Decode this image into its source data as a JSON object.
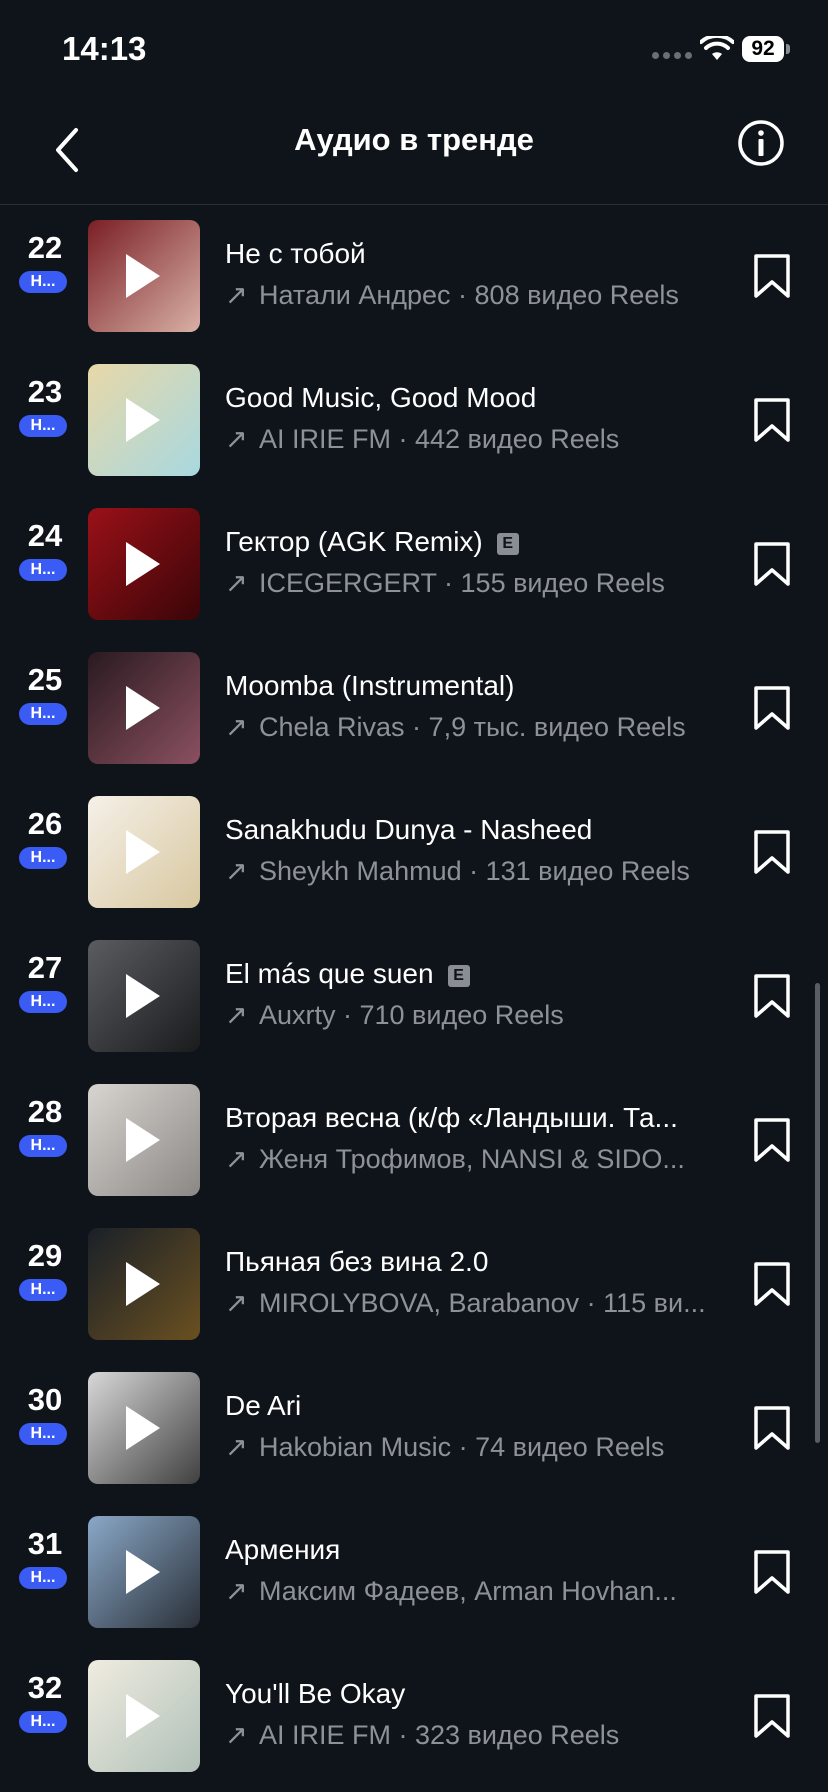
{
  "status": {
    "time": "14:13",
    "battery": "92"
  },
  "header": {
    "title": "Аудио в тренде"
  },
  "badge_label": "Н...",
  "tracks": [
    {
      "rank": "22",
      "title": "Не с тобой",
      "explicit": false,
      "meta": "Натали Андрес · 808 видео Reels",
      "color1": "#7a1f25",
      "color2": "#d8b0a5"
    },
    {
      "rank": "23",
      "title": "Good Music, Good Mood",
      "explicit": false,
      "meta": "AI IRIE FM · 442 видео Reels",
      "color1": "#e8d8a8",
      "color2": "#a8d8e0"
    },
    {
      "rank": "24",
      "title": "Гектор (AGK Remix)",
      "explicit": true,
      "meta": "ICEGERGERT · 155 видео Reels",
      "color1": "#9a1118",
      "color2": "#3a0508"
    },
    {
      "rank": "25",
      "title": "Moomba (Instrumental)",
      "explicit": false,
      "meta": "Chela Rivas · 7,9 тыс. видео Reels",
      "color1": "#2a1a20",
      "color2": "#8a5060"
    },
    {
      "rank": "26",
      "title": "Sanakhudu Dunya - Nasheed",
      "explicit": false,
      "meta": "Sheykh Mahmud · 131 видео Reels",
      "color1": "#f5f0e8",
      "color2": "#d8c8a0"
    },
    {
      "rank": "27",
      "title": "El más que suen",
      "explicit": true,
      "meta": "Auxrty · 710 видео Reels",
      "color1": "#5a5c60",
      "color2": "#1a1b1d"
    },
    {
      "rank": "28",
      "title": "Вторая весна (к/ф «Ландыши. Та...",
      "explicit": false,
      "meta": "Женя Трофимов, NANSI & SIDO...",
      "color1": "#d8d5d0",
      "color2": "#8a8785"
    },
    {
      "rank": "29",
      "title": "Пьяная без вина 2.0",
      "explicit": false,
      "meta": "MIROLYBOVA, Barabanov · 115 ви...",
      "color1": "#1a2028",
      "color2": "#6a5020"
    },
    {
      "rank": "30",
      "title": "De Ari",
      "explicit": false,
      "meta": "Hakobian Music · 74 видео Reels",
      "color1": "#d8d8d8",
      "color2": "#404040"
    },
    {
      "rank": "31",
      "title": "Армения",
      "explicit": false,
      "meta": "Максим Фадеев, Arman Hovhan...",
      "color1": "#8aa8c8",
      "color2": "#2a3038"
    },
    {
      "rank": "32",
      "title": "You'll Be Okay",
      "explicit": false,
      "meta": "AI IRIE FM · 323 видео Reels",
      "color1": "#f0ece0",
      "color2": "#b0c0b8"
    }
  ],
  "colors": {
    "background": "#0f141a",
    "badge": "#3a5cf5",
    "secondary_text": "#8e9297"
  }
}
